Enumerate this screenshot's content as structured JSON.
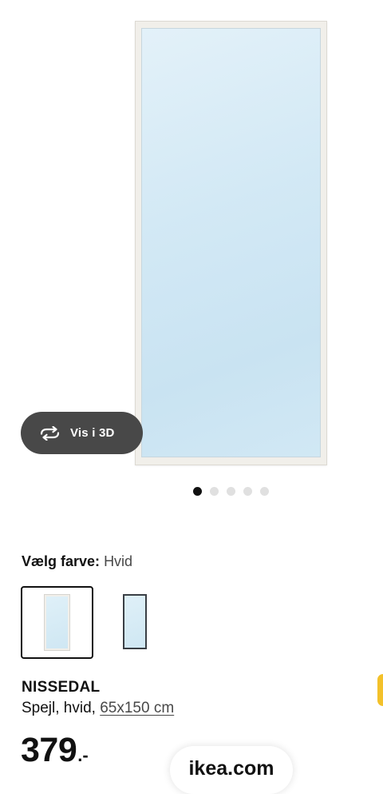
{
  "gallery": {
    "view_3d_label": "Vis i 3D",
    "image_count": 5,
    "active_image_index": 1
  },
  "color_selection": {
    "label": "Vælg farve:",
    "selected": "Hvid",
    "swatches": [
      {
        "name": "white-frame",
        "selected": true
      },
      {
        "name": "dark-frame",
        "selected": false
      }
    ]
  },
  "product": {
    "name": "NISSEDAL",
    "description": "Spejl, hvid,",
    "size": "65x150 cm",
    "price_integer": "379",
    "price_suffix": ".-"
  },
  "browser": {
    "url": "ikea.com"
  },
  "colors": {
    "text": "#111111",
    "secondary_text": "#484848",
    "button_dark": "#484848",
    "accent_yellow": "#f3c12a",
    "mirror_glass": "#d3e9f5"
  }
}
